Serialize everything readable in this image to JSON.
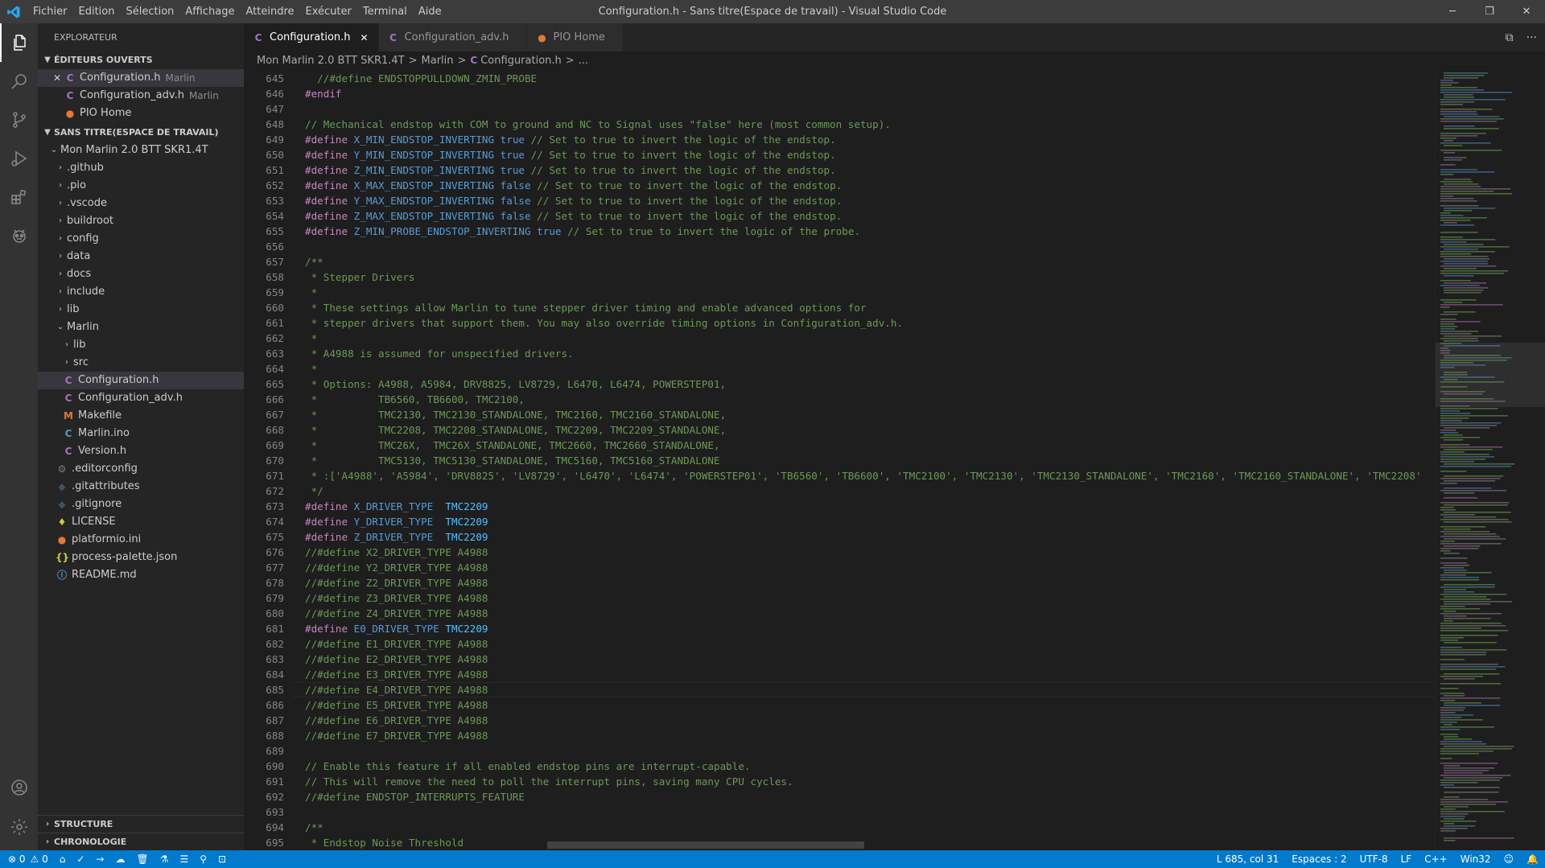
{
  "window": {
    "title": "Configuration.h - Sans titre(Espace de travail) - Visual Studio Code",
    "menu": [
      "Fichier",
      "Edition",
      "Sélection",
      "Affichage",
      "Atteindre",
      "Exécuter",
      "Terminal",
      "Aide"
    ],
    "minimize_glyph": "─",
    "restore_glyph": "❐",
    "close_glyph": "✕"
  },
  "sidebar": {
    "header": "EXPLORATEUR",
    "open_editors": {
      "label": "ÉDITEURS OUVERTS",
      "items": [
        {
          "name": "Configuration.h",
          "desc": "Marlin",
          "icon": "C",
          "close": "✕"
        },
        {
          "name": "Configuration_adv.h",
          "desc": "Marlin",
          "icon": "C"
        },
        {
          "name": "PIO Home",
          "desc": "",
          "icon": "●"
        }
      ]
    },
    "workspace": {
      "label": "SANS TITRE(ESPACE DE TRAVAIL)",
      "root": "Mon Marlin 2.0 BTT SKR1.4T",
      "folders": [
        ".github",
        ".pio",
        ".vscode",
        "buildroot",
        "config",
        "data",
        "docs",
        "include",
        "lib"
      ],
      "marlin": "Marlin",
      "marlin_sub": [
        "lib",
        "src"
      ],
      "marlin_files": [
        {
          "name": "Configuration.h",
          "icon": "C"
        },
        {
          "name": "Configuration_adv.h",
          "icon": "C"
        },
        {
          "name": "Makefile",
          "icon": "M"
        },
        {
          "name": "Marlin.ino",
          "icon": "C"
        },
        {
          "name": "Version.h",
          "icon": "C"
        }
      ],
      "root_files": [
        {
          "name": ".editorconfig",
          "icon": "⚙"
        },
        {
          "name": ".gitattributes",
          "icon": "◆"
        },
        {
          "name": ".gitignore",
          "icon": "◆"
        },
        {
          "name": "LICENSE",
          "icon": "♦"
        },
        {
          "name": "platformio.ini",
          "icon": "●"
        },
        {
          "name": "process-palette.json",
          "icon": "{}"
        },
        {
          "name": "README.md",
          "icon": "ⓘ"
        }
      ]
    },
    "outline": "STRUCTURE",
    "timeline": "CHRONOLOGIE"
  },
  "tabs": [
    {
      "label": "Configuration.h",
      "icon": "C",
      "active": true,
      "close": "✕"
    },
    {
      "label": "Configuration_adv.h",
      "icon": "C",
      "active": false
    },
    {
      "label": "PIO Home",
      "icon": "●",
      "active": false
    }
  ],
  "tab_actions": {
    "split": "⧉",
    "more": "···"
  },
  "breadcrumb": {
    "root": "Mon Marlin 2.0 BTT SKR1.4T",
    "folder": "Marlin",
    "file": "Configuration.h",
    "icon": "C",
    "more": "...",
    "sep": ">"
  },
  "editor": {
    "current_line": 685,
    "lines": [
      {
        "n": "645",
        "t": "  //#define ENDSTOPPULLDOWN_ZMIN_PROBE"
      },
      {
        "n": "646",
        "t": "#endif"
      },
      {
        "n": "647",
        "t": ""
      },
      {
        "n": "648",
        "t": "// Mechanical endstop with COM to ground and NC to Signal uses \"false\" here (most common setup)."
      },
      {
        "n": "649",
        "t": "#define X_MIN_ENDSTOP_INVERTING true // Set to true to invert the logic of the endstop."
      },
      {
        "n": "650",
        "t": "#define Y_MIN_ENDSTOP_INVERTING true // Set to true to invert the logic of the endstop."
      },
      {
        "n": "651",
        "t": "#define Z_MIN_ENDSTOP_INVERTING true // Set to true to invert the logic of the endstop."
      },
      {
        "n": "652",
        "t": "#define X_MAX_ENDSTOP_INVERTING false // Set to true to invert the logic of the endstop."
      },
      {
        "n": "653",
        "t": "#define Y_MAX_ENDSTOP_INVERTING false // Set to true to invert the logic of the endstop."
      },
      {
        "n": "654",
        "t": "#define Z_MAX_ENDSTOP_INVERTING false // Set to true to invert the logic of the endstop."
      },
      {
        "n": "655",
        "t": "#define Z_MIN_PROBE_ENDSTOP_INVERTING true // Set to true to invert the logic of the probe."
      },
      {
        "n": "656",
        "t": ""
      },
      {
        "n": "657",
        "t": "/**"
      },
      {
        "n": "658",
        "t": " * Stepper Drivers"
      },
      {
        "n": "659",
        "t": " *"
      },
      {
        "n": "660",
        "t": " * These settings allow Marlin to tune stepper driver timing and enable advanced options for"
      },
      {
        "n": "661",
        "t": " * stepper drivers that support them. You may also override timing options in Configuration_adv.h."
      },
      {
        "n": "662",
        "t": " *"
      },
      {
        "n": "663",
        "t": " * A4988 is assumed for unspecified drivers."
      },
      {
        "n": "664",
        "t": " *"
      },
      {
        "n": "665",
        "t": " * Options: A4988, A5984, DRV8825, LV8729, L6470, L6474, POWERSTEP01,"
      },
      {
        "n": "666",
        "t": " *          TB6560, TB6600, TMC2100,"
      },
      {
        "n": "667",
        "t": " *          TMC2130, TMC2130_STANDALONE, TMC2160, TMC2160_STANDALONE,"
      },
      {
        "n": "668",
        "t": " *          TMC2208, TMC2208_STANDALONE, TMC2209, TMC2209_STANDALONE,"
      },
      {
        "n": "669",
        "t": " *          TMC26X,  TMC26X_STANDALONE, TMC2660, TMC2660_STANDALONE,"
      },
      {
        "n": "670",
        "t": " *          TMC5130, TMC5130_STANDALONE, TMC5160, TMC5160_STANDALONE"
      },
      {
        "n": "671",
        "t": " * :['A4988', 'A5984', 'DRV8825', 'LV8729', 'L6470', 'L6474', 'POWERSTEP01', 'TB6560', 'TB6600', 'TMC2100', 'TMC2130', 'TMC2130_STANDALONE', 'TMC2160', 'TMC2160_STANDALONE', 'TMC2208'"
      },
      {
        "n": "672",
        "t": " */"
      },
      {
        "n": "673",
        "t": "#define X_DRIVER_TYPE  TMC2209"
      },
      {
        "n": "674",
        "t": "#define Y_DRIVER_TYPE  TMC2209"
      },
      {
        "n": "675",
        "t": "#define Z_DRIVER_TYPE  TMC2209"
      },
      {
        "n": "676",
        "t": "//#define X2_DRIVER_TYPE A4988"
      },
      {
        "n": "677",
        "t": "//#define Y2_DRIVER_TYPE A4988"
      },
      {
        "n": "678",
        "t": "//#define Z2_DRIVER_TYPE A4988"
      },
      {
        "n": "679",
        "t": "//#define Z3_DRIVER_TYPE A4988"
      },
      {
        "n": "680",
        "t": "//#define Z4_DRIVER_TYPE A4988"
      },
      {
        "n": "681",
        "t": "#define E0_DRIVER_TYPE TMC2209"
      },
      {
        "n": "682",
        "t": "//#define E1_DRIVER_TYPE A4988"
      },
      {
        "n": "683",
        "t": "//#define E2_DRIVER_TYPE A4988"
      },
      {
        "n": "684",
        "t": "//#define E3_DRIVER_TYPE A4988"
      },
      {
        "n": "685",
        "t": "//#define E4_DRIVER_TYPE A4988"
      },
      {
        "n": "686",
        "t": "//#define E5_DRIVER_TYPE A4988"
      },
      {
        "n": "687",
        "t": "//#define E6_DRIVER_TYPE A4988"
      },
      {
        "n": "688",
        "t": "//#define E7_DRIVER_TYPE A4988"
      },
      {
        "n": "689",
        "t": ""
      },
      {
        "n": "690",
        "t": "// Enable this feature if all enabled endstop pins are interrupt-capable."
      },
      {
        "n": "691",
        "t": "// This will remove the need to poll the interrupt pins, saving many CPU cycles."
      },
      {
        "n": "692",
        "t": "//#define ENDSTOP_INTERRUPTS_FEATURE"
      },
      {
        "n": "693",
        "t": ""
      },
      {
        "n": "694",
        "t": "/**"
      },
      {
        "n": "695",
        "t": " * Endstop Noise Threshold"
      }
    ]
  },
  "statusbar": {
    "errors": "⊗ 0",
    "warnings": "⚠ 0",
    "icons": [
      "⌂",
      "✓",
      "→",
      "☁",
      "🗑",
      "⚗",
      "☰",
      "⚲",
      "⊡"
    ],
    "position": "L 685, col 31",
    "spaces": "Espaces : 2",
    "encoding": "UTF-8",
    "eol": "LF",
    "language": "C++",
    "platform": "Win32",
    "feedback": "☺",
    "bell": "🔔"
  },
  "colors": {
    "accent": "#007acc",
    "comment": "#6a9955",
    "preprocessor": "#c586c0",
    "keyword": "#569cd6",
    "identifier": "#4fc1ff"
  }
}
